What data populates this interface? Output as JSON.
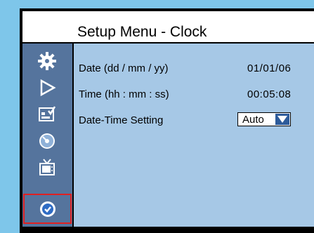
{
  "header": {
    "title": "Setup Menu - Clock"
  },
  "sidebar": {
    "items": [
      {
        "icon": "gear-icon"
      },
      {
        "icon": "play-icon"
      },
      {
        "icon": "picture-icon"
      },
      {
        "icon": "disc-icon"
      },
      {
        "icon": "tv-icon"
      },
      {
        "icon": "clock-icon",
        "selected": true
      }
    ]
  },
  "settings": {
    "date": {
      "label": "Date (dd / mm / yy)",
      "value": "01/01/06"
    },
    "time": {
      "label": "Time (hh : mm : ss)",
      "value": "00:05:08"
    },
    "datetime": {
      "label": "Date-Time Setting",
      "value": "Auto"
    }
  },
  "colors": {
    "background": "#7ec6ea",
    "content": "#a6c8e6",
    "sidebar": "#55749d",
    "selection": "#e02020"
  }
}
